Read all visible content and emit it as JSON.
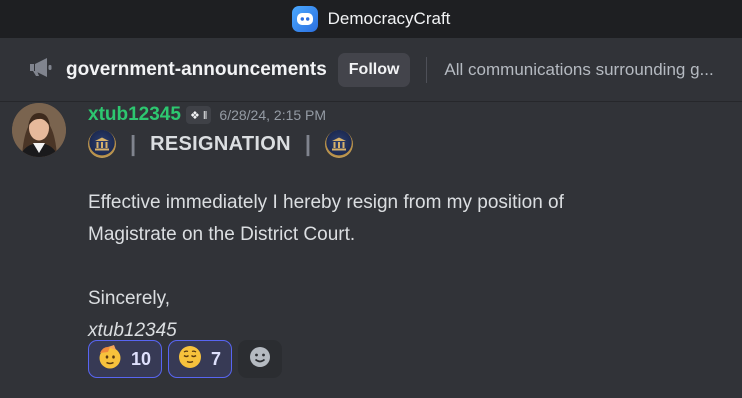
{
  "app": {
    "title": "DemocracyCraft",
    "icon": "discord-app-icon"
  },
  "channel": {
    "icon": "announcement-megaphone-icon",
    "name": "government-announcements",
    "follow_label": "Follow",
    "topic": "All communications surrounding g..."
  },
  "message": {
    "avatar": "user-avatar",
    "username": "xtub12345",
    "tag_label": "❖ ‖",
    "timestamp": "6/28/24, 2:15 PM",
    "heading": {
      "left_emoji": "court-seal-emoji",
      "pipe_left": "|",
      "title": "RESIGNATION",
      "pipe_right": "|",
      "right_emoji": "court-seal-emoji"
    },
    "lines": [
      "Effective immediately I hereby resign from my position of",
      "Magistrate on the District Court.",
      "Sincerely,",
      "xtub12345"
    ]
  },
  "reactions": [
    {
      "emoji": "saluting-face-emoji",
      "count": "10"
    },
    {
      "emoji": "relieved-face-emoji",
      "count": "7"
    }
  ],
  "add_reaction": {
    "icon": "add-reaction-icon"
  },
  "colors": {
    "background": "#313338",
    "username": "#2dc770",
    "reaction_active_border": "#5865f2",
    "reaction_active_bg": "#373a55"
  }
}
